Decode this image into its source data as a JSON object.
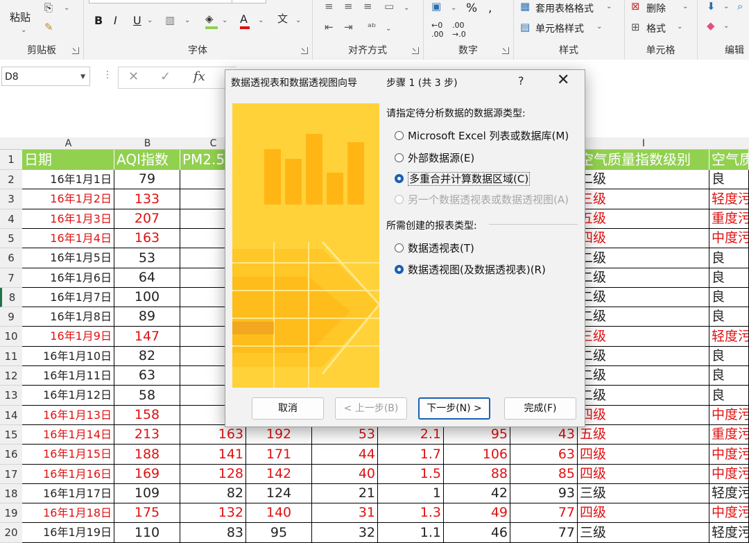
{
  "ribbon": {
    "paste": "粘贴",
    "clipboard_label": "剪贴板",
    "font_label": "字体",
    "align_label": "对齐方式",
    "number_label": "数字",
    "styles_label": "样式",
    "cells_label": "单元格",
    "edit_label": "编辑",
    "bold": "B",
    "italic": "I",
    "underline": "U",
    "percent": "%",
    "conditional_format": "套用表格格式",
    "cell_styles": "单元格样式",
    "delete": "删除",
    "format": "格式"
  },
  "namebox": {
    "value": "D8"
  },
  "formula": {
    "cancel": "✕",
    "enter": "✓",
    "fx": "fx"
  },
  "columns": [
    "A",
    "B",
    "C",
    "I"
  ],
  "headers": {
    "a": "日期",
    "b": "AQI指数",
    "c": "PM2.5",
    "i": "空气质量指数级别",
    "j": "空气质"
  },
  "rows": [
    {
      "n": "2",
      "date": "16年1月1日",
      "aqi": "79",
      "level": "二级",
      "qual": "良",
      "red": false
    },
    {
      "n": "3",
      "date": "16年1月2日",
      "aqi": "133",
      "pm": "1",
      "level": "三级",
      "qual": "轻度污",
      "red": true
    },
    {
      "n": "4",
      "date": "16年1月3日",
      "aqi": "207",
      "pm": "1",
      "level": "五级",
      "qual": "重度污",
      "red": true
    },
    {
      "n": "5",
      "date": "16年1月4日",
      "aqi": "163",
      "pm": "1",
      "level": "四级",
      "qual": "中度污",
      "red": true
    },
    {
      "n": "6",
      "date": "16年1月5日",
      "aqi": "53",
      "level": "二级",
      "qual": "良",
      "red": false
    },
    {
      "n": "7",
      "date": "16年1月6日",
      "aqi": "64",
      "level": "二级",
      "qual": "良",
      "red": false
    },
    {
      "n": "8",
      "date": "16年1月7日",
      "aqi": "100",
      "level": "二级",
      "qual": "良",
      "red": false
    },
    {
      "n": "9",
      "date": "16年1月8日",
      "aqi": "89",
      "level": "二级",
      "qual": "良",
      "red": false
    },
    {
      "n": "10",
      "date": "16年1月9日",
      "aqi": "147",
      "pm": "1",
      "level": "三级",
      "qual": "轻度污",
      "red": true
    },
    {
      "n": "11",
      "date": "16年1月10日",
      "aqi": "82",
      "level": "二级",
      "qual": "良",
      "red": false
    },
    {
      "n": "12",
      "date": "16年1月11日",
      "aqi": "63",
      "level": "二级",
      "qual": "良",
      "red": false
    },
    {
      "n": "13",
      "date": "16年1月12日",
      "aqi": "58",
      "level": "二级",
      "qual": "良",
      "red": false
    },
    {
      "n": "14",
      "date": "16年1月13日",
      "aqi": "158",
      "pm": "1",
      "level": "四级",
      "qual": "中度污",
      "red": true
    },
    {
      "n": "15",
      "date": "16年1月14日",
      "aqi": "213",
      "pm": "163",
      "d": "192",
      "e": "53",
      "f": "2.1",
      "g": "95",
      "h": "43",
      "level": "五级",
      "qual": "重度污",
      "red": true
    },
    {
      "n": "16",
      "date": "16年1月15日",
      "aqi": "188",
      "pm": "141",
      "d": "171",
      "e": "44",
      "f": "1.7",
      "g": "106",
      "h": "63",
      "level": "四级",
      "qual": "中度污",
      "red": true
    },
    {
      "n": "17",
      "date": "16年1月16日",
      "aqi": "169",
      "pm": "128",
      "d": "142",
      "e": "40",
      "f": "1.5",
      "g": "88",
      "h": "85",
      "level": "四级",
      "qual": "中度污",
      "red": true
    },
    {
      "n": "18",
      "date": "16年1月17日",
      "aqi": "109",
      "pm": "82",
      "d": "124",
      "e": "21",
      "f": "1",
      "g": "42",
      "h": "93",
      "level": "三级",
      "qual": "轻度污",
      "red": false
    },
    {
      "n": "19",
      "date": "16年1月18日",
      "aqi": "175",
      "pm": "132",
      "d": "140",
      "e": "31",
      "f": "1.3",
      "g": "49",
      "h": "77",
      "level": "四级",
      "qual": "中度污",
      "red": true
    },
    {
      "n": "20",
      "date": "16年1月19日",
      "aqi": "110",
      "pm": "83",
      "d": "95",
      "e": "32",
      "f": "1.1",
      "g": "46",
      "h": "77",
      "level": "三级",
      "qual": "轻度污",
      "red": false
    }
  ],
  "dialog": {
    "title": "数据透视表和数据透视图向导",
    "step": "步骤 1 (共 3 步)",
    "help": "?",
    "close": "✕",
    "section1": "请指定待分析数据的数据源类型:",
    "opt1": "Microsoft Excel 列表或数据库(M)",
    "opt2": "外部数据源(E)",
    "opt3": "多重合并计算数据区域(C)",
    "opt4": "另一个数据透视表或数据透视图(A)",
    "section2": "所需创建的报表类型:",
    "opt5": "数据透视表(T)",
    "opt6": "数据透视图(及数据透视表)(R)",
    "cancel": "取消",
    "prev": "< 上一步(B)",
    "next": "下一步(N) >",
    "finish": "完成(F)"
  }
}
